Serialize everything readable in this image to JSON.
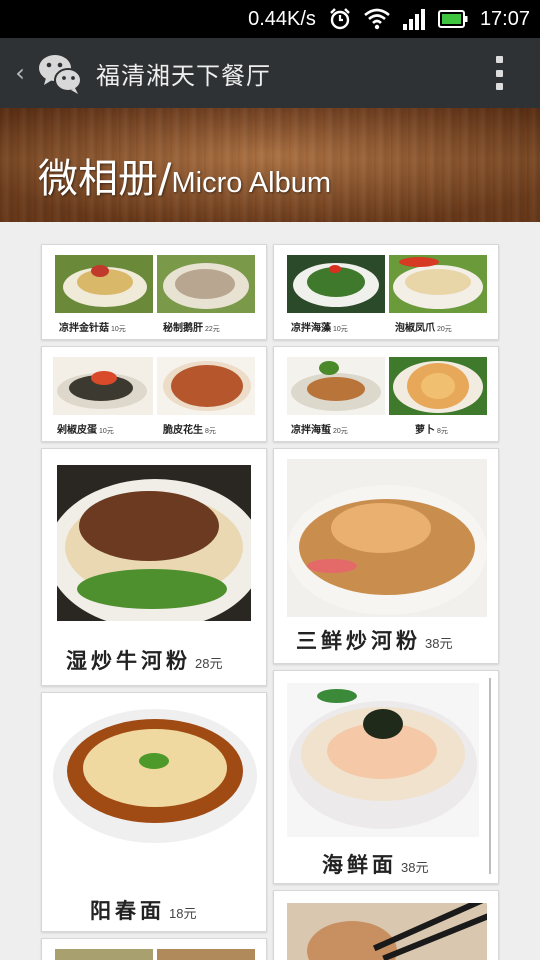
{
  "status_bar": {
    "network_speed": "0.44K/s",
    "time": "17:07",
    "icons": [
      "alarm-icon",
      "wifi-icon",
      "signal-icon",
      "battery-icon"
    ]
  },
  "title_bar": {
    "title": "福清湘天下餐厅",
    "icons": [
      "back-icon",
      "wechat-icon",
      "more-menu-icon"
    ]
  },
  "banner": {
    "title_cn": "微相册/",
    "title_en": "Micro Album"
  },
  "album": {
    "left_column": [
      {
        "type": "pair",
        "items": [
          {
            "name": "凉拌金针菇",
            "price": "10元"
          },
          {
            "name": "秘制鹅肝",
            "price": "22元"
          }
        ]
      },
      {
        "type": "pair",
        "items": [
          {
            "name": "剁椒皮蛋",
            "price": "10元"
          },
          {
            "name": "脆皮花生",
            "price": "8元"
          }
        ]
      },
      {
        "type": "single",
        "name": "湿炒牛河粉",
        "price": "28元"
      },
      {
        "type": "single",
        "name": "阳春面",
        "price": "18元"
      }
    ],
    "right_column": [
      {
        "type": "pair",
        "items": [
          {
            "name": "凉拌海藻",
            "price": "10元"
          },
          {
            "name": "泡椒凤爪",
            "price": "20元"
          }
        ]
      },
      {
        "type": "pair",
        "items": [
          {
            "name": "凉拌海蜇",
            "price": "20元"
          },
          {
            "name": "萝卜",
            "price": "8元"
          }
        ]
      },
      {
        "type": "single",
        "name": "三鲜炒河粉",
        "price": "38元"
      },
      {
        "type": "single",
        "name": "海鲜面",
        "price": "38元"
      }
    ]
  },
  "colors": {
    "status_bar_bg": "#000000",
    "title_bar_bg": "#2f3234",
    "banner_wood": "#8a4b22",
    "page_bg": "#eeeeee",
    "card_bg": "#ffffff"
  }
}
